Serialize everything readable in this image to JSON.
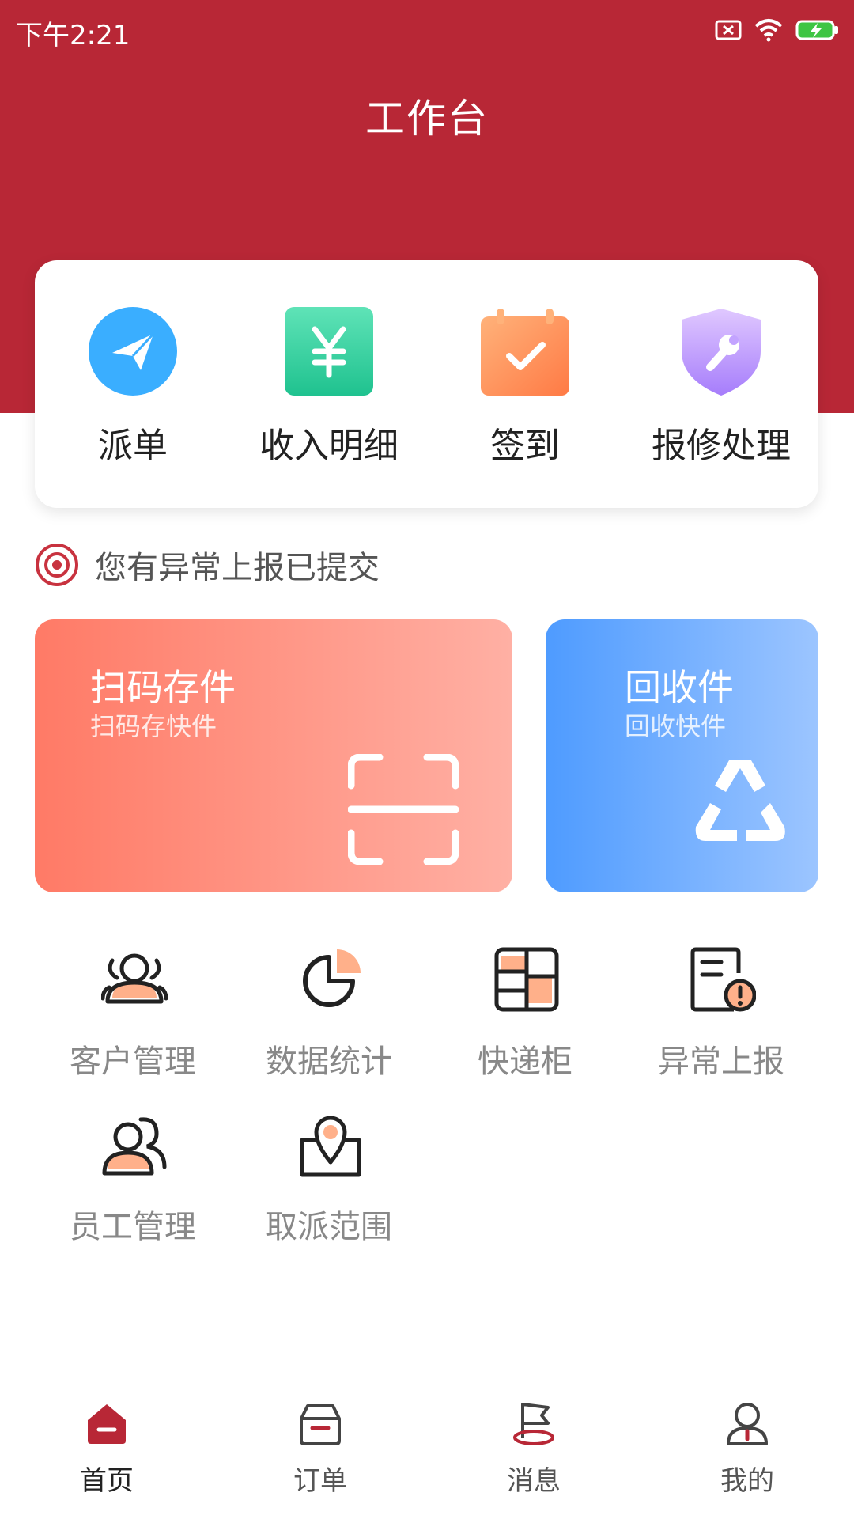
{
  "status_bar": {
    "time": "下午2:21"
  },
  "header": {
    "title": "工作台"
  },
  "quick_actions": [
    {
      "label": "派单",
      "icon": "paper-plane-icon",
      "color": "#3aaeff"
    },
    {
      "label": "收入明细",
      "icon": "yuan-icon",
      "color": "#25c99b"
    },
    {
      "label": "签到",
      "icon": "calendar-check-icon",
      "color": "#ff8c55"
    },
    {
      "label": "报修处理",
      "icon": "shield-wrench-icon",
      "color": "#b99bff"
    }
  ],
  "notice": {
    "text": "您有异常上报已提交",
    "icon": "target-icon"
  },
  "feature_cards": [
    {
      "title": "扫码存件",
      "subtitle": "扫码存快件",
      "icon": "scan-icon"
    },
    {
      "title": "回收件",
      "subtitle": "回收快件",
      "icon": "recycle-icon"
    }
  ],
  "grid": [
    {
      "label": "客户管理",
      "icon": "customers-icon"
    },
    {
      "label": "数据统计",
      "icon": "pie-chart-icon"
    },
    {
      "label": "快递柜",
      "icon": "locker-icon"
    },
    {
      "label": "异常上报",
      "icon": "report-alert-icon"
    },
    {
      "label": "员工管理",
      "icon": "staff-icon"
    },
    {
      "label": "取派范围",
      "icon": "map-range-icon"
    }
  ],
  "bottom_nav": [
    {
      "label": "首页",
      "icon": "home-icon",
      "active": true
    },
    {
      "label": "订单",
      "icon": "order-box-icon",
      "active": false
    },
    {
      "label": "消息",
      "icon": "message-flag-icon",
      "active": false
    },
    {
      "label": "我的",
      "icon": "profile-icon",
      "active": false
    }
  ],
  "colors": {
    "brand": "#b82736",
    "accent_orange": "#ffb08a",
    "text_muted": "#888888"
  }
}
